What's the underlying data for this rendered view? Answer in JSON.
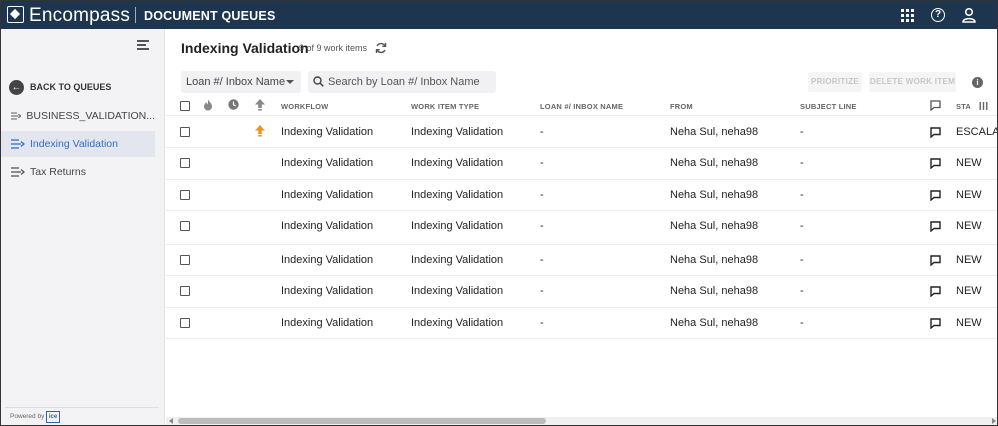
{
  "topbar": {
    "brand": "Encompass",
    "module": "DOCUMENT QUEUES",
    "help_glyph": "?"
  },
  "sidebar": {
    "back_label": "BACK TO QUEUES",
    "items": [
      {
        "label": "BUSINESS_VALIDATION...",
        "active": false
      },
      {
        "label": "Indexing Validation",
        "active": true
      },
      {
        "label": "Tax Returns",
        "active": false
      }
    ],
    "powered_by": "Powered by",
    "powered_logo": "ice"
  },
  "main": {
    "title": "Indexing Validation",
    "count": "9 of 9 work items",
    "filter_value": "Loan #/ Inbox Name",
    "search_placeholder": "Search by Loan #/ Inbox Name",
    "prioritize_label": "PRIORITIZE",
    "delete_label": "DELETE WORK ITEM",
    "info_glyph": "i"
  },
  "table": {
    "columns": [
      "WORKFLOW",
      "WORK ITEM TYPE",
      "LOAN #/ INBOX NAME",
      "FROM",
      "SUBJECT LINE",
      "STA"
    ],
    "rows": [
      {
        "workflow": "Indexing Validation",
        "type": "Indexing Validation",
        "loan": "-",
        "from": "Neha Sul, neha98",
        "subject": "-",
        "status": "ESCALAT",
        "priority": true
      },
      {
        "workflow": "Indexing Validation",
        "type": "Indexing Validation",
        "loan": "-",
        "from": "Neha Sul, neha98",
        "subject": "-",
        "status": "NEW",
        "priority": false
      },
      {
        "workflow": "Indexing Validation",
        "type": "Indexing Validation",
        "loan": "-",
        "from": "Neha Sul, neha98",
        "subject": "-",
        "status": "NEW",
        "priority": false
      },
      {
        "workflow": "Indexing Validation",
        "type": "Indexing Validation",
        "loan": "-",
        "from": "Neha Sul, neha98",
        "subject": "-",
        "status": "NEW",
        "priority": false
      },
      {
        "workflow": "Indexing Validation",
        "type": "Indexing Validation",
        "loan": "-",
        "from": "Neha Sul, neha98",
        "subject": "-",
        "status": "NEW",
        "priority": false
      },
      {
        "workflow": "Indexing Validation",
        "type": "Indexing Validation",
        "loan": "-",
        "from": "Neha Sul, neha98",
        "subject": "-",
        "status": "NEW",
        "priority": false
      },
      {
        "workflow": "Indexing Validation",
        "type": "Indexing Validation",
        "loan": "-",
        "from": "Neha Sul, neha98",
        "subject": "-",
        "status": "NEW",
        "priority": false
      }
    ]
  },
  "colors": {
    "topbar": "#1e3550",
    "active_nav": "#2f6fc9",
    "priority_arrow": "#f0961e"
  },
  "icons": [
    "logo-icon",
    "apps-grid-icon",
    "help-icon",
    "user-icon",
    "collapse-menu-icon",
    "back-arrow-icon",
    "queue-icon",
    "refresh-icon",
    "search-icon",
    "info-icon",
    "flame-icon",
    "clock-icon",
    "priority-arrow-icon",
    "comment-icon",
    "column-settings-icon"
  ]
}
